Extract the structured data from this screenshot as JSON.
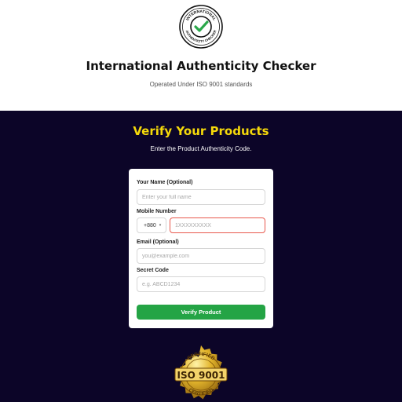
{
  "header": {
    "logo": {
      "icon": "check-seal-icon",
      "top_text": "INTERNATIONAL",
      "bottom_text": "AUTHENTICITY CHECKER",
      "accent": "#2aa84a"
    },
    "title": "International Authenticity Checker",
    "subtitle": "Operated Under ISO 9001 standards"
  },
  "hero": {
    "title": "Verify Your Products",
    "subtitle": "Enter the Product Authenticity Code.",
    "title_color": "#f5d90a",
    "background": "#0c0528"
  },
  "form": {
    "name_label": "Your Name (Optional)",
    "name_placeholder": "Enter your full name",
    "mobile_label": "Mobile Number",
    "country_code": "+880",
    "mobile_placeholder": "1XXXXXXXXX",
    "email_label": "Email (Optional)",
    "email_placeholder": "you@example.com",
    "code_label": "Secret Code",
    "code_placeholder": "e.g. ABCD1234",
    "submit_label": "Verify Product",
    "submit_color": "#24a445",
    "error_border_color": "#e8584d"
  },
  "badge": {
    "icon": "iso-certified-seal-icon",
    "top_text": "CERTIFIED",
    "main_text": "ISO 9001",
    "bottom_text": "CERTIFIED",
    "color": "#d4a017"
  }
}
